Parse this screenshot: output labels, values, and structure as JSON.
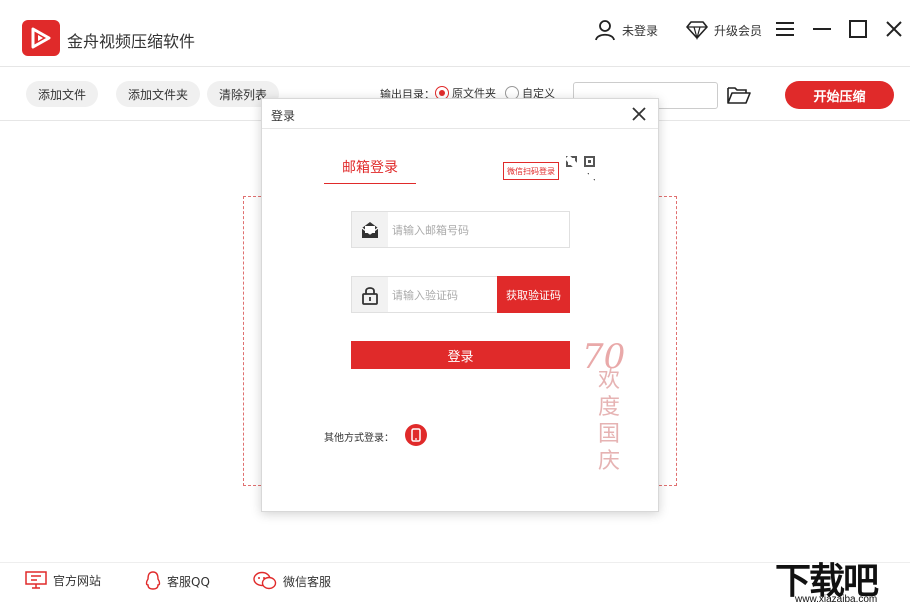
{
  "app": {
    "title": "金舟视频压缩软件"
  },
  "header": {
    "login_status": "未登录",
    "upgrade_label": "升级会员"
  },
  "toolbar": {
    "add_file": "添加文件",
    "add_folder": "添加文件夹",
    "clear_list": "清除列表",
    "output_label": "输出目录：",
    "opt_original": "原文件夹",
    "opt_custom": "自定义",
    "output_path": "",
    "start_button": "开始压缩"
  },
  "dialog": {
    "title": "登录",
    "tab_email": "邮箱登录",
    "qr_badge": "微信扫码登录",
    "email_placeholder": "请输入邮箱号码",
    "email_value": "",
    "code_placeholder": "请输入验证码",
    "code_value": "",
    "get_code_button": "获取验证码",
    "login_button": "登录",
    "other_methods_label": "其他方式登录：",
    "decoration": {
      "number": "70",
      "text": "欢度国庆"
    }
  },
  "footer": {
    "website": "官方网站",
    "service_qq": "客服QQ",
    "service_wechat": "微信客服"
  },
  "watermark": {
    "big": "下载吧",
    "small": "www.xiazaiba.com"
  },
  "colors": {
    "accent": "#e02a2a",
    "border": "#e0e0e0",
    "pill_bg": "#f0f0f0"
  },
  "icons": {
    "logo": "play-logo-icon",
    "user": "user-icon",
    "vip": "diamond-icon",
    "menu": "menu-icon",
    "minimize": "minimize-icon",
    "maximize": "maximize-icon",
    "close": "close-icon",
    "folder": "folder-open-icon",
    "email": "envelope-icon",
    "lock": "lock-icon",
    "qr": "qr-code-icon",
    "phone": "phone-icon",
    "monitor": "monitor-icon",
    "qq": "qq-penguin-icon",
    "wechat": "wechat-icon"
  }
}
